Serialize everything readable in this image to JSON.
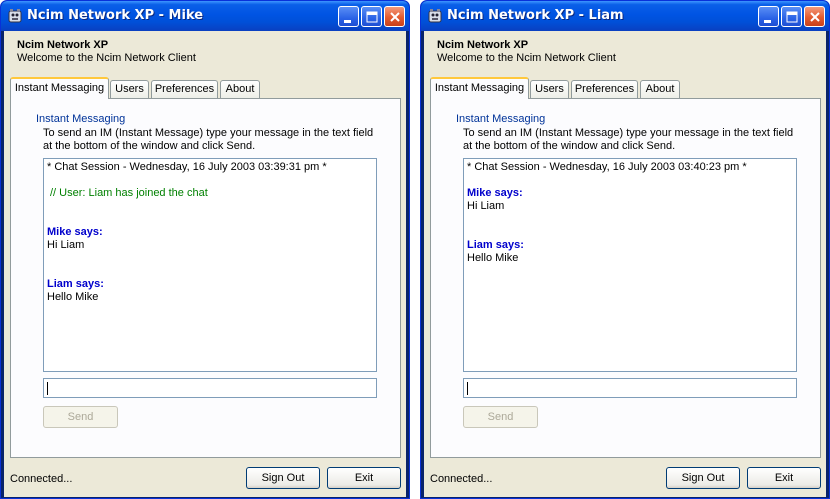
{
  "windows": [
    {
      "title": "Ncim Network XP - Mike",
      "app_title": "Ncim Network XP",
      "app_subtitle": "Welcome to the Ncim Network Client",
      "tabs": [
        "Instant Messaging",
        "Users",
        "Preferences",
        "About"
      ],
      "active_tab": "Instant Messaging",
      "section_title": "Instant Messaging",
      "instructions_line1": "To send an IM (Instant Message) type your message in the text field",
      "instructions_line2": "at the bottom of the window and click Send.",
      "chat": {
        "header": "* Chat Session - Wednesday, 16 July 2003   03:39:31 pm *",
        "system": "// User: Liam has joined the chat",
        "entries": [
          {
            "speaker": "Mike says:",
            "message": "Hi Liam"
          },
          {
            "speaker": "Liam says:",
            "message": "Hello Mike"
          }
        ]
      },
      "input_value": "",
      "send_label": "Send",
      "status": "Connected...",
      "signout_label": "Sign Out",
      "exit_label": "Exit"
    },
    {
      "title": "Ncim Network XP - Liam",
      "app_title": "Ncim Network XP",
      "app_subtitle": "Welcome to the Ncim Network Client",
      "tabs": [
        "Instant Messaging",
        "Users",
        "Preferences",
        "About"
      ],
      "active_tab": "Instant Messaging",
      "section_title": "Instant Messaging",
      "instructions_line1": "To send an IM (Instant Message) type your message in the text field",
      "instructions_line2": "at the bottom of the window and click Send.",
      "chat": {
        "header": "* Chat Session - Wednesday, 16 July 2003   03:40:23 pm *",
        "entries": [
          {
            "speaker": "Mike says:",
            "message": "Hi Liam"
          },
          {
            "speaker": "Liam says:",
            "message": "Hello Mike"
          }
        ]
      },
      "input_value": "",
      "send_label": "Send",
      "status": "Connected...",
      "signout_label": "Sign Out",
      "exit_label": "Exit"
    }
  ],
  "colors": {
    "titlebar": "#0054e3",
    "client_bg": "#ece9d8",
    "section_title": "#003399",
    "system_message": "#008000",
    "speaker": "#0000cc"
  }
}
